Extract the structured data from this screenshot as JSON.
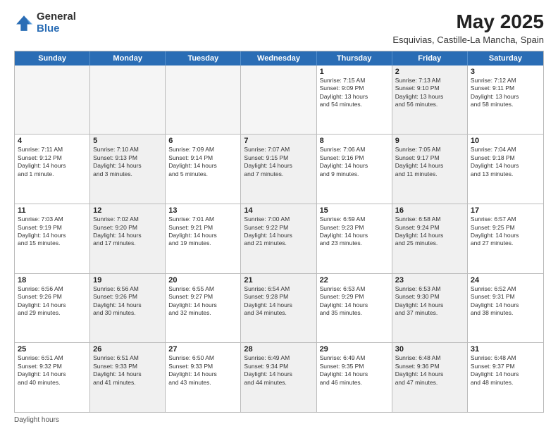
{
  "header": {
    "logo_general": "General",
    "logo_blue": "Blue",
    "month_title": "May 2025",
    "location": "Esquivias, Castille-La Mancha, Spain"
  },
  "days_of_week": [
    "Sunday",
    "Monday",
    "Tuesday",
    "Wednesday",
    "Thursday",
    "Friday",
    "Saturday"
  ],
  "footer_text": "Daylight hours",
  "weeks": [
    [
      {
        "num": "",
        "info": "",
        "empty": true
      },
      {
        "num": "",
        "info": "",
        "empty": true
      },
      {
        "num": "",
        "info": "",
        "empty": true
      },
      {
        "num": "",
        "info": "",
        "empty": true
      },
      {
        "num": "1",
        "info": "Sunrise: 7:15 AM\nSunset: 9:09 PM\nDaylight: 13 hours\nand 54 minutes."
      },
      {
        "num": "2",
        "info": "Sunrise: 7:13 AM\nSunset: 9:10 PM\nDaylight: 13 hours\nand 56 minutes.",
        "shaded": true
      },
      {
        "num": "3",
        "info": "Sunrise: 7:12 AM\nSunset: 9:11 PM\nDaylight: 13 hours\nand 58 minutes."
      }
    ],
    [
      {
        "num": "4",
        "info": "Sunrise: 7:11 AM\nSunset: 9:12 PM\nDaylight: 14 hours\nand 1 minute."
      },
      {
        "num": "5",
        "info": "Sunrise: 7:10 AM\nSunset: 9:13 PM\nDaylight: 14 hours\nand 3 minutes.",
        "shaded": true
      },
      {
        "num": "6",
        "info": "Sunrise: 7:09 AM\nSunset: 9:14 PM\nDaylight: 14 hours\nand 5 minutes."
      },
      {
        "num": "7",
        "info": "Sunrise: 7:07 AM\nSunset: 9:15 PM\nDaylight: 14 hours\nand 7 minutes.",
        "shaded": true
      },
      {
        "num": "8",
        "info": "Sunrise: 7:06 AM\nSunset: 9:16 PM\nDaylight: 14 hours\nand 9 minutes."
      },
      {
        "num": "9",
        "info": "Sunrise: 7:05 AM\nSunset: 9:17 PM\nDaylight: 14 hours\nand 11 minutes.",
        "shaded": true
      },
      {
        "num": "10",
        "info": "Sunrise: 7:04 AM\nSunset: 9:18 PM\nDaylight: 14 hours\nand 13 minutes."
      }
    ],
    [
      {
        "num": "11",
        "info": "Sunrise: 7:03 AM\nSunset: 9:19 PM\nDaylight: 14 hours\nand 15 minutes."
      },
      {
        "num": "12",
        "info": "Sunrise: 7:02 AM\nSunset: 9:20 PM\nDaylight: 14 hours\nand 17 minutes.",
        "shaded": true
      },
      {
        "num": "13",
        "info": "Sunrise: 7:01 AM\nSunset: 9:21 PM\nDaylight: 14 hours\nand 19 minutes."
      },
      {
        "num": "14",
        "info": "Sunrise: 7:00 AM\nSunset: 9:22 PM\nDaylight: 14 hours\nand 21 minutes.",
        "shaded": true
      },
      {
        "num": "15",
        "info": "Sunrise: 6:59 AM\nSunset: 9:23 PM\nDaylight: 14 hours\nand 23 minutes."
      },
      {
        "num": "16",
        "info": "Sunrise: 6:58 AM\nSunset: 9:24 PM\nDaylight: 14 hours\nand 25 minutes.",
        "shaded": true
      },
      {
        "num": "17",
        "info": "Sunrise: 6:57 AM\nSunset: 9:25 PM\nDaylight: 14 hours\nand 27 minutes."
      }
    ],
    [
      {
        "num": "18",
        "info": "Sunrise: 6:56 AM\nSunset: 9:26 PM\nDaylight: 14 hours\nand 29 minutes."
      },
      {
        "num": "19",
        "info": "Sunrise: 6:56 AM\nSunset: 9:26 PM\nDaylight: 14 hours\nand 30 minutes.",
        "shaded": true
      },
      {
        "num": "20",
        "info": "Sunrise: 6:55 AM\nSunset: 9:27 PM\nDaylight: 14 hours\nand 32 minutes."
      },
      {
        "num": "21",
        "info": "Sunrise: 6:54 AM\nSunset: 9:28 PM\nDaylight: 14 hours\nand 34 minutes.",
        "shaded": true
      },
      {
        "num": "22",
        "info": "Sunrise: 6:53 AM\nSunset: 9:29 PM\nDaylight: 14 hours\nand 35 minutes."
      },
      {
        "num": "23",
        "info": "Sunrise: 6:53 AM\nSunset: 9:30 PM\nDaylight: 14 hours\nand 37 minutes.",
        "shaded": true
      },
      {
        "num": "24",
        "info": "Sunrise: 6:52 AM\nSunset: 9:31 PM\nDaylight: 14 hours\nand 38 minutes."
      }
    ],
    [
      {
        "num": "25",
        "info": "Sunrise: 6:51 AM\nSunset: 9:32 PM\nDaylight: 14 hours\nand 40 minutes."
      },
      {
        "num": "26",
        "info": "Sunrise: 6:51 AM\nSunset: 9:33 PM\nDaylight: 14 hours\nand 41 minutes.",
        "shaded": true
      },
      {
        "num": "27",
        "info": "Sunrise: 6:50 AM\nSunset: 9:33 PM\nDaylight: 14 hours\nand 43 minutes."
      },
      {
        "num": "28",
        "info": "Sunrise: 6:49 AM\nSunset: 9:34 PM\nDaylight: 14 hours\nand 44 minutes.",
        "shaded": true
      },
      {
        "num": "29",
        "info": "Sunrise: 6:49 AM\nSunset: 9:35 PM\nDaylight: 14 hours\nand 46 minutes."
      },
      {
        "num": "30",
        "info": "Sunrise: 6:48 AM\nSunset: 9:36 PM\nDaylight: 14 hours\nand 47 minutes.",
        "shaded": true
      },
      {
        "num": "31",
        "info": "Sunrise: 6:48 AM\nSunset: 9:37 PM\nDaylight: 14 hours\nand 48 minutes."
      }
    ]
  ]
}
